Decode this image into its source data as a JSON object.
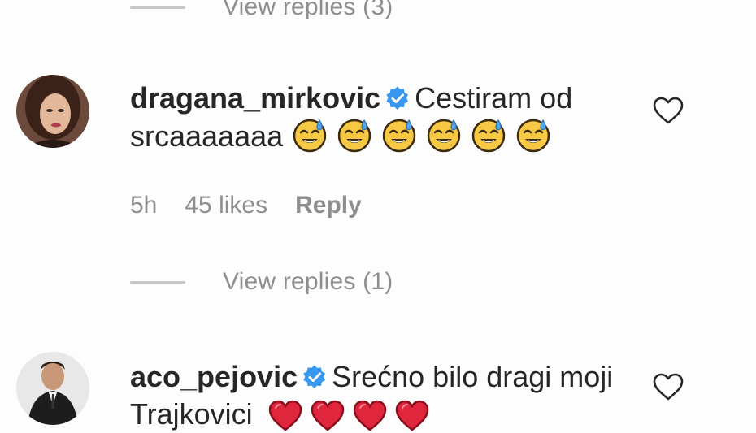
{
  "top_replies": {
    "label": "View replies (3)"
  },
  "comments": [
    {
      "username": "dragana_mirkovic",
      "text": "Cestiram od srcaaaaaaa",
      "emojis": [
        "smiling-face-with-sweat-icon",
        "smiling-face-with-sweat-icon",
        "smiling-face-with-sweat-icon",
        "smiling-face-with-sweat-icon",
        "smiling-face-with-sweat-icon",
        "smiling-face-with-sweat-icon"
      ],
      "time": "5h",
      "likes": "45 likes",
      "reply_label": "Reply",
      "view_replies": "View replies (1)"
    },
    {
      "username": "aco_pejovic",
      "text": "Srećno bilo dragi moji Trajkovici",
      "emojis": [
        "red-heart-icon",
        "red-heart-icon",
        "red-heart-icon",
        "red-heart-icon"
      ]
    }
  ],
  "colors": {
    "text": "#262626",
    "secondary": "#8e8e8e",
    "verified": "#3897f0",
    "heart": "#e0263d",
    "background": "#fdfdfd"
  }
}
